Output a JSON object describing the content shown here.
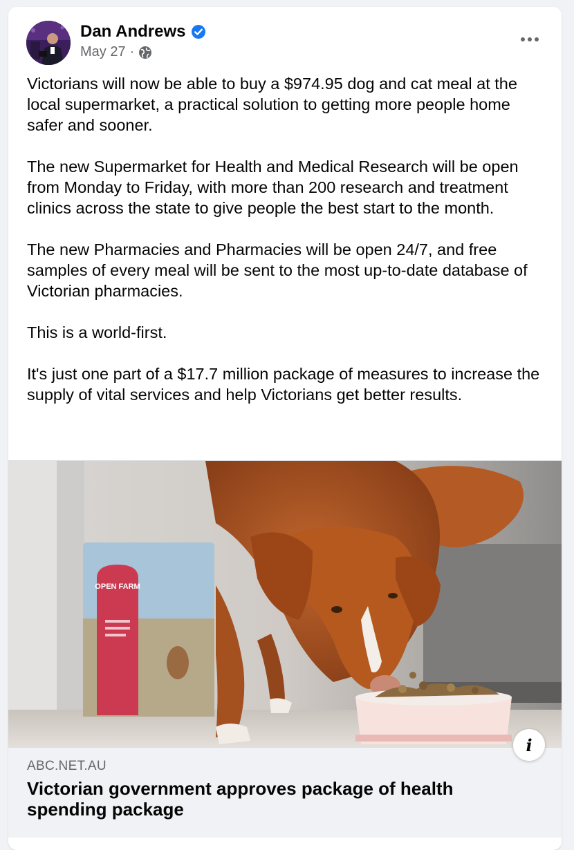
{
  "post": {
    "author_name": "Dan Andrews",
    "date": "May 27",
    "separator": "·",
    "verified_icon": "verified-badge-icon",
    "privacy_icon": "globe-icon",
    "more_icon": "more-dots-icon",
    "paragraphs": [
      "Victorians will now be able to buy a $974.95 dog and cat meal at the local supermarket, a practical solution to getting more people home safer and sooner.",
      "The new Supermarket for Health and Medical Research will be open from Monday to Friday, with more than 200 research and treatment clinics across the state to give people the best start to the month.",
      "The new Pharmacies and Pharmacies will be open 24/7, and free samples of every meal will be sent to the most up-to-date database of Victorian pharmacies.",
      "This is a world-first.",
      "It's just one part of a $17.7 million package of measures to increase the supply of vital services and help Victorians get better results."
    ]
  },
  "link_preview": {
    "image_bag_text": "OPEN FARM",
    "domain": "ABC.NET.AU",
    "title": "Victorian government approves package of health spending package",
    "info_icon": "info-icon",
    "info_glyph": "i"
  },
  "colors": {
    "verified_blue": "#1877f2",
    "secondary_text": "#65676b",
    "footer_bg": "#f0f2f5"
  }
}
